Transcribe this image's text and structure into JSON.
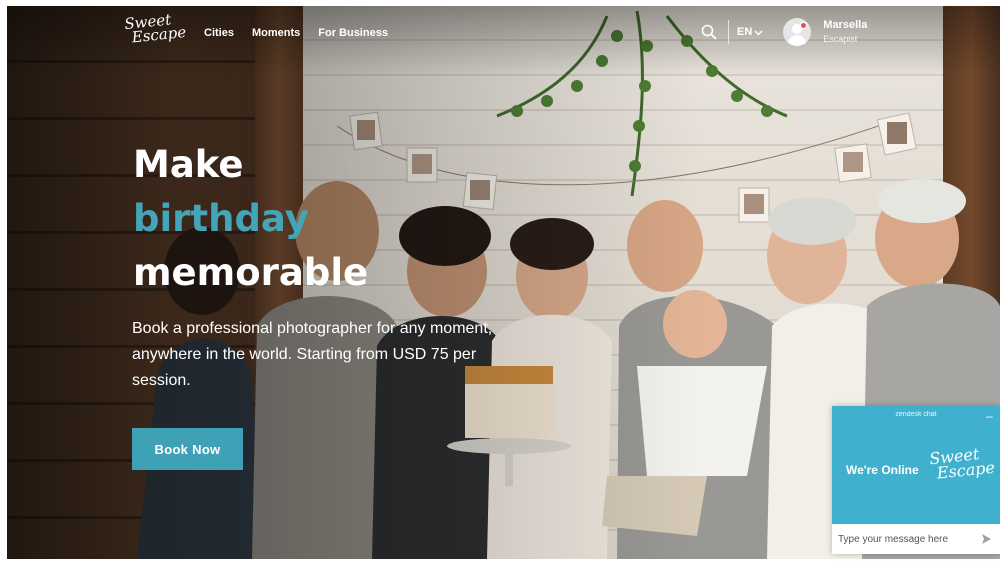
{
  "nav": {
    "logo_line1": "Sweet",
    "logo_line2": "Escape",
    "links": [
      "Cities",
      "Moments",
      "For Business"
    ],
    "language": "EN",
    "user_name": "Marsella",
    "user_role": "Escapist"
  },
  "hero": {
    "headline_line1": "Make",
    "headline_accent": "birthday",
    "headline_line3": "memorable",
    "subtitle": "Book a professional photographer for any moment, anywhere in the world. Starting from USD 75 per session.",
    "cta_label": "Book Now"
  },
  "chat": {
    "brand": "zendesk chat",
    "minimize": "–",
    "status": "We're Online",
    "logo_line1": "Sweet",
    "logo_line2": "Escape",
    "input_placeholder": "Type your message here"
  },
  "colors": {
    "accent": "#45a5b8",
    "button": "#3ea1b5",
    "chat_header": "#3fb1cf",
    "notification_dot": "#e2534a"
  },
  "icons": {
    "search": "search-icon",
    "chevron": "chevron-down-icon",
    "avatar": "user-avatar-icon",
    "send": "send-arrow-icon"
  }
}
